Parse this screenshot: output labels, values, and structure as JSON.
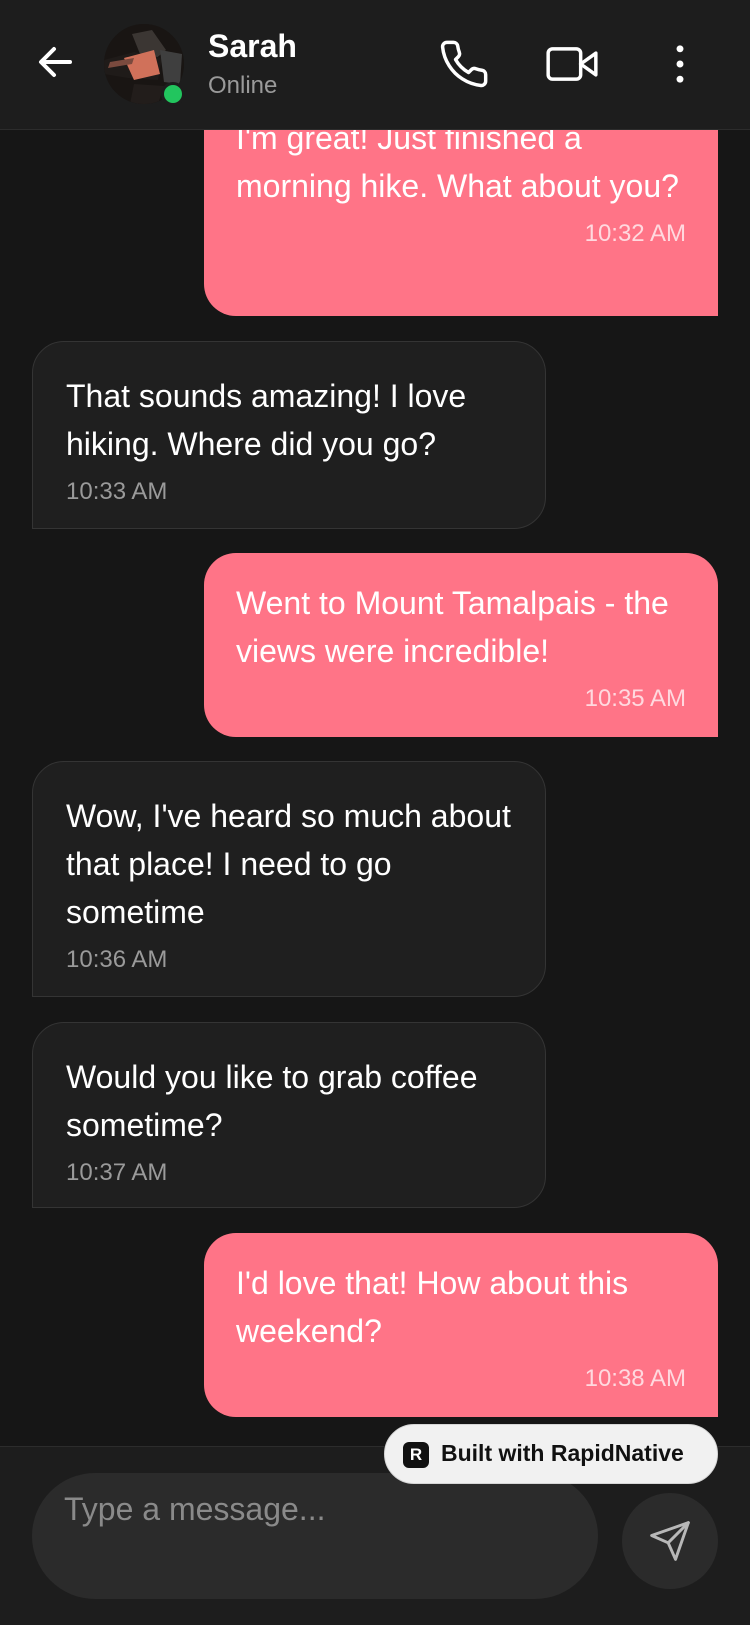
{
  "header": {
    "contact_name": "Sarah",
    "status": "Online",
    "icons": {
      "back": "arrow-left-icon",
      "avatar": "avatar",
      "call": "phone-icon",
      "video": "video-camera-icon",
      "more": "more-vertical-icon"
    },
    "colors": {
      "online": "#22c55e"
    }
  },
  "messages": [
    {
      "sender": "me",
      "text": "I'm great! Just finished a morning hike. What about you?",
      "time": "10:32 AM"
    },
    {
      "sender": "them",
      "text": "That sounds amazing! I love hiking. Where did you go?",
      "time": "10:33 AM"
    },
    {
      "sender": "me",
      "text": "Went to Mount Tamalpais - the views were incredible!",
      "time": "10:35 AM"
    },
    {
      "sender": "them",
      "text": "Wow, I've heard so much about that place! I need to go sometime",
      "time": "10:36 AM"
    },
    {
      "sender": "them",
      "text": "Would you like to grab coffee sometime?",
      "time": "10:37 AM"
    },
    {
      "sender": "me",
      "text": "I'd love that! How about this weekend?",
      "time": "10:38 AM"
    }
  ],
  "composer": {
    "placeholder": "Type a message...",
    "value": "",
    "send_icon": "send-icon"
  },
  "badge": {
    "logo_letter": "R",
    "text": "Built with RapidNative"
  },
  "theme": {
    "background": "#161616",
    "header": "#1d1d1d",
    "outgoing_bubble": "#ff7487",
    "incoming_bubble": "#1f1f1f"
  }
}
